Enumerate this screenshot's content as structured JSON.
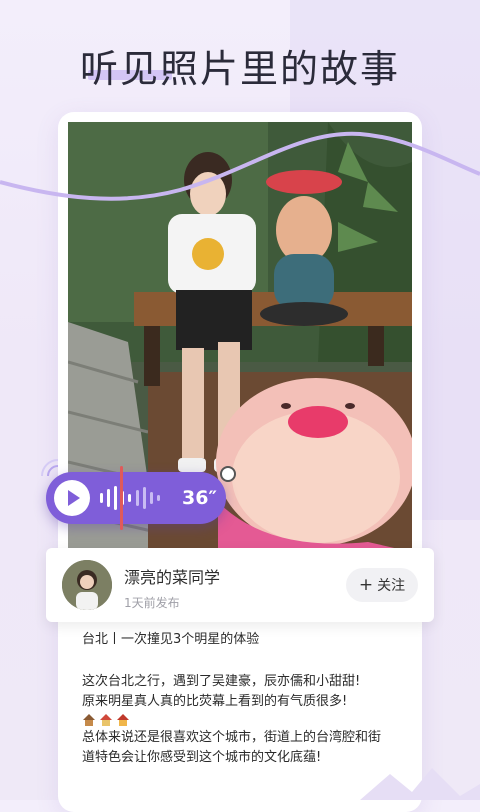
{
  "headline": "听见照片里的故事",
  "audio": {
    "duration": "36″"
  },
  "user": {
    "name": "漂亮的菜同学",
    "post_time": "1天前发布",
    "follow_label": "关注"
  },
  "post": {
    "title": "台北丨一次撞见3个明星的体验",
    "lines": [
      "这次台北之行，遇到了吴建豪，辰亦儒和小甜甜!",
      "原来明星真人真的比荧幕上看到的有气质很多!",
      "总体来说还是很喜欢这个城市，街道上的台湾腔和街",
      "道特色会让你感受到这个城市的文化底蕴!"
    ]
  },
  "colors": {
    "accent": "#7f5ed9",
    "progress": "#e05a5a"
  },
  "icons": [
    "play-icon",
    "plus-icon",
    "house-emoji-icon",
    "sound-wave-icon"
  ]
}
